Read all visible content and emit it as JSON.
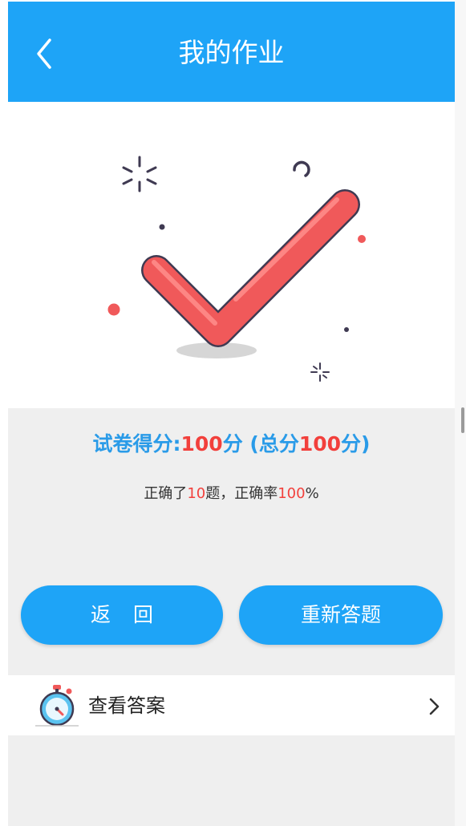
{
  "header": {
    "title": "我的作业",
    "back_icon": "chevron-left-icon",
    "background": "#1ea4f7"
  },
  "hero": {
    "icon": "check-mark-illustration"
  },
  "result": {
    "score_label": "试卷得分:",
    "score_value": "100",
    "score_unit": "分",
    "total_open": " (总分",
    "total_value": "100",
    "total_close": "分)",
    "correct_prefix": "正确了",
    "correct_count": "10",
    "correct_mid": "题，正确率",
    "accuracy_value": "100",
    "accuracy_suffix": "%",
    "highlight_color": "#f2403c",
    "label_color": "#2a9be8"
  },
  "buttons": {
    "back_label": "返回",
    "retry_label": "重新答题"
  },
  "answer_row": {
    "label": "查看答案",
    "icon": "stopwatch-icon",
    "arrow_icon": "chevron-right-icon"
  }
}
